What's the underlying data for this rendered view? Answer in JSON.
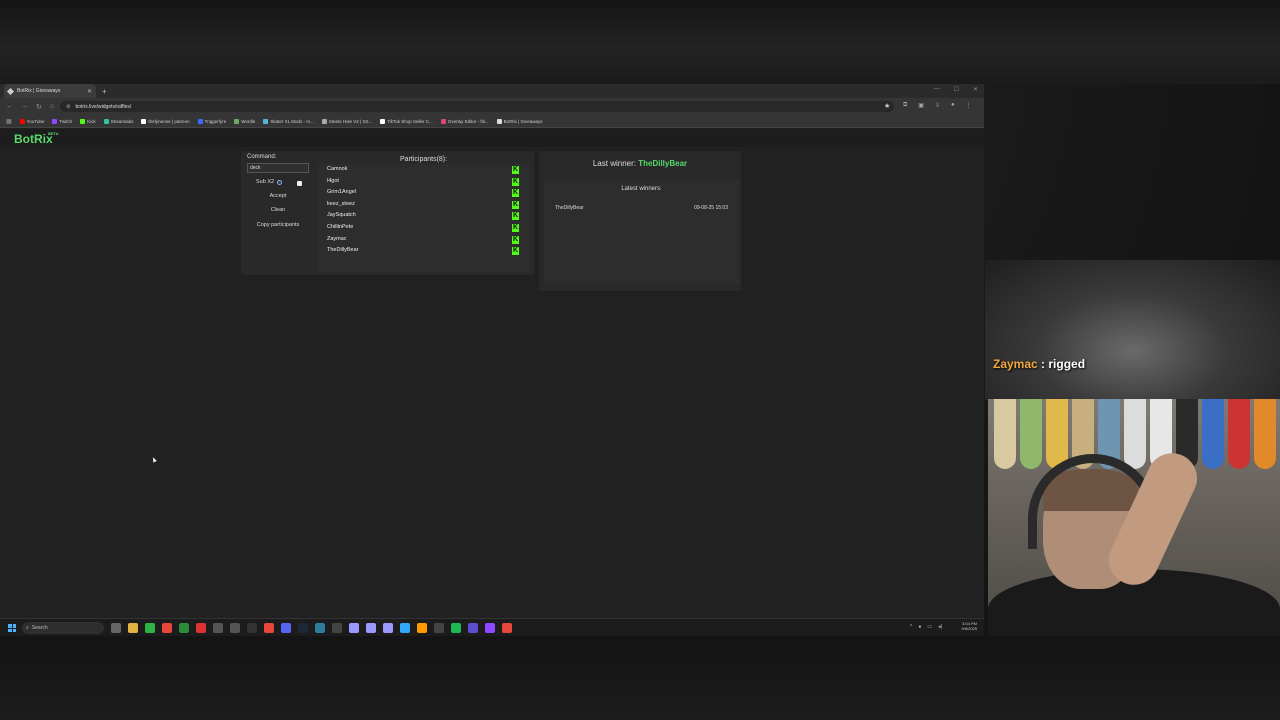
{
  "browser": {
    "tab_title": "BotRix | Giveaways",
    "url": "botrix.live/widgets/raffles/",
    "bookmarks": [
      {
        "label": "YouTube",
        "color": "#ff0000"
      },
      {
        "label": "Twitch",
        "color": "#9146ff"
      },
      {
        "label": "Kick",
        "color": "#53fc18"
      },
      {
        "label": "Streamlabs",
        "color": "#31c3a2"
      },
      {
        "label": "thefyneone | patreon",
        "color": "#ffffff"
      },
      {
        "label": "Triggerfyre",
        "color": "#3b6bff"
      },
      {
        "label": "Wordle",
        "color": "#6aaa64"
      },
      {
        "label": "Skater XL Mods - m...",
        "color": "#58b7d8"
      },
      {
        "label": "Steelo Hole V2 | SS...",
        "color": "#aaaaaa"
      },
      {
        "label": "TikTok Shop Seller C...",
        "color": "#ffffff"
      },
      {
        "label": "Overlay Editor - fiti...",
        "color": "#e0457b"
      },
      {
        "label": "BotRix | Giveaways",
        "color": "#dddddd"
      }
    ]
  },
  "app": {
    "logo": "BotRix",
    "logo_badge": "BETA"
  },
  "raffle": {
    "command_label": "Command:",
    "command_value": "deck",
    "sub_label": "Sub X2",
    "accept_label": "Accept",
    "clean_label": "Clean",
    "copy_label": "Copy participants",
    "participants_title": "Participants(8):",
    "participants": [
      "Camnok",
      "l4got",
      "Grim1Angel",
      "keez_steez",
      "JaySquatch",
      "ChillinPete",
      "Zaymac",
      "TheDillyBear"
    ],
    "participant_platform_icon": "kick-icon",
    "kick_color": "#53fc18"
  },
  "winners": {
    "last_winner_label": "Last winner:",
    "last_winner_name": "TheDillyBear",
    "latest_title": "Latest winners:",
    "latest": [
      {
        "name": "TheDillyBear",
        "date": "09-08-25 15:03"
      }
    ]
  },
  "taskbar": {
    "search_label": "Search",
    "time": "3:04 PM",
    "date": "9/8/2025"
  },
  "stream_overlay": {
    "chat_user": "Zaymac",
    "chat_separator": " : ",
    "chat_message": "rigged",
    "chat_user_color": "#f2a93b"
  }
}
